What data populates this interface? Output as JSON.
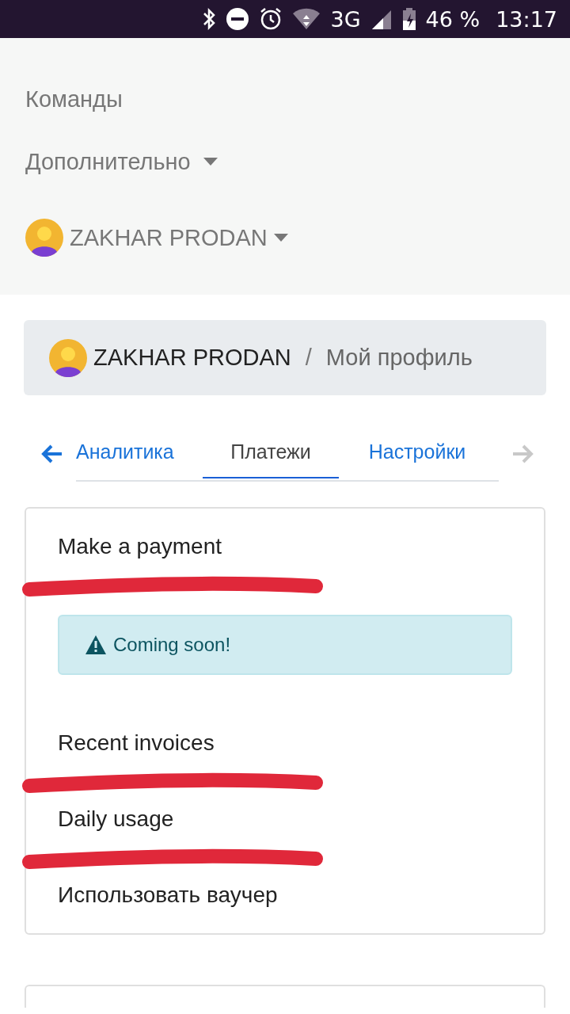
{
  "status_bar": {
    "network": "3G",
    "battery": "46 %",
    "time": "13:17"
  },
  "nav": {
    "items": [
      {
        "label": "Команды",
        "kind": "link"
      },
      {
        "label": "Дополнительно",
        "kind": "dropdown"
      }
    ],
    "user": {
      "name": "ZAKHAR PRODAN"
    }
  },
  "breadcrumb": {
    "user": "ZAKHAR PRODAN",
    "separator": "/",
    "current": "Мой профиль"
  },
  "tabs": {
    "prev_disabled": false,
    "next_disabled": true,
    "items": [
      {
        "label": "Аналитика",
        "selected": false
      },
      {
        "label": "Платежи",
        "selected": true
      },
      {
        "label": "Настройки",
        "selected": false
      }
    ]
  },
  "payments_card": {
    "sections": [
      {
        "kind": "header",
        "title": "Make a payment",
        "underlined": true
      },
      {
        "kind": "alert",
        "text": "Coming soon!"
      },
      {
        "kind": "header",
        "title": "Recent invoices",
        "underlined": true
      },
      {
        "kind": "header",
        "title": "Daily usage",
        "underlined": true
      },
      {
        "kind": "header",
        "title": "Использовать ваучер",
        "underlined": false
      }
    ]
  }
}
